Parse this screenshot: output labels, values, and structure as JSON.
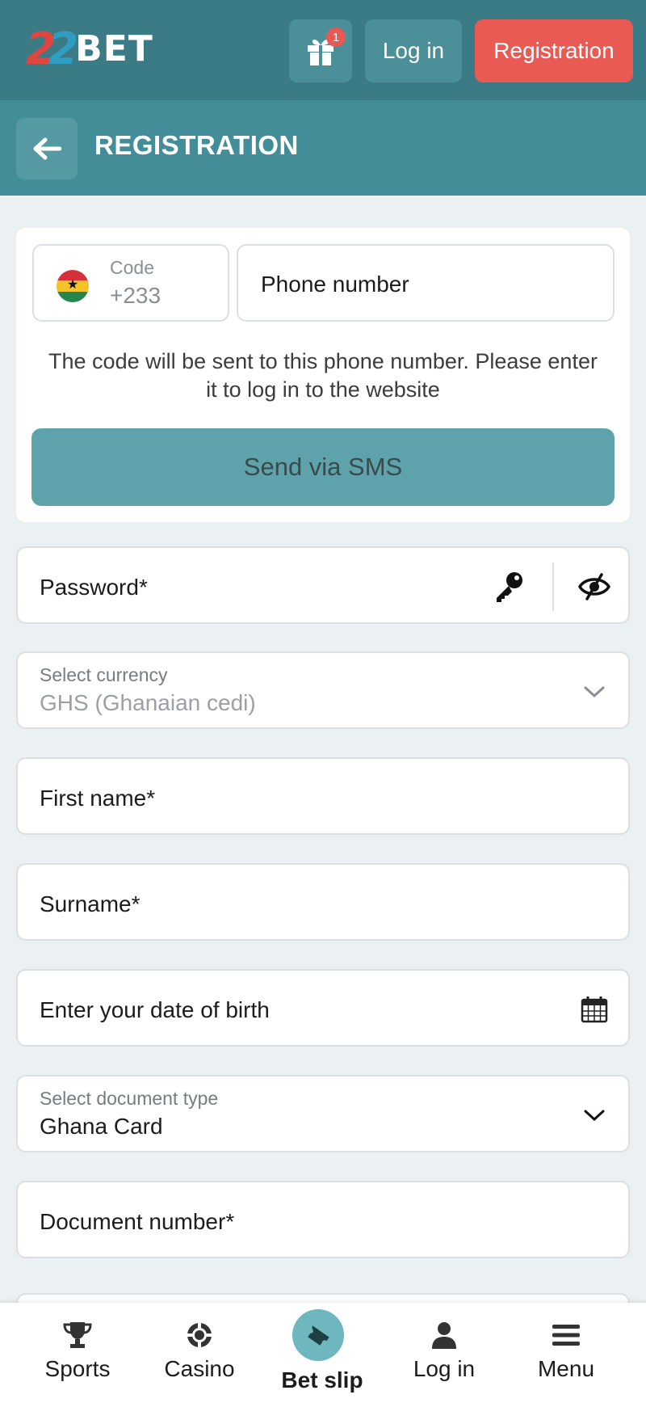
{
  "header": {
    "logo_num_a": "2",
    "logo_num_b": "2",
    "logo_text": "BET",
    "gift_badge": "1",
    "login_label": "Log in",
    "register_label": "Registration"
  },
  "page": {
    "title": "REGISTRATION"
  },
  "phone": {
    "code_label": "Code",
    "code_value": "+233",
    "phone_placeholder": "Phone number",
    "hint": "The code will be sent to this phone number. Please enter it to log in to the website",
    "send_button": "Send via SMS"
  },
  "form": {
    "password_label": "Password*",
    "currency_label": "Select currency",
    "currency_value": "GHS (Ghanaian cedi)",
    "first_name_label": "First name*",
    "surname_label": "Surname*",
    "dob_label": "Enter your date of birth",
    "doc_type_label": "Select document type",
    "doc_type_value": "Ghana Card",
    "doc_number_label": "Document number*"
  },
  "nav": {
    "items": [
      {
        "label": "Sports",
        "icon": "trophy-icon"
      },
      {
        "label": "Casino",
        "icon": "chip-icon"
      },
      {
        "label": "Bet slip",
        "icon": "ticket-icon"
      },
      {
        "label": "Log in",
        "icon": "user-icon"
      },
      {
        "label": "Menu",
        "icon": "hamburger-icon"
      }
    ]
  },
  "colors": {
    "header_bg": "#3b7b86",
    "page_header_bg": "#428d98",
    "registration_button": "#ea5a55",
    "sms_button": "#5ea3ac",
    "page_bg": "#ebf1f3"
  }
}
